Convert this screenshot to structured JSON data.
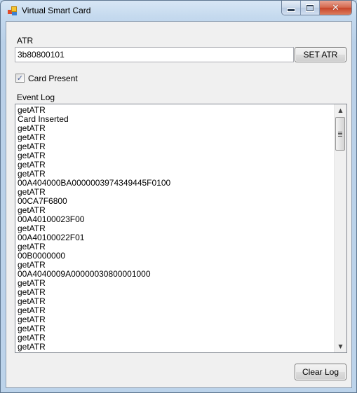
{
  "window": {
    "title": "Virtual Smart Card",
    "minimize_label": "minimize",
    "maximize_label": "maximize",
    "close_glyph": "✕"
  },
  "atr": {
    "label": "ATR",
    "value": "3b80800101",
    "set_button": "SET ATR"
  },
  "card_present": {
    "label": "Card Present",
    "checked": true,
    "check_glyph": "✓"
  },
  "event_log": {
    "label": "Event Log",
    "lines": [
      "getATR",
      "Card Inserted",
      "getATR",
      "getATR",
      "getATR",
      "getATR",
      "getATR",
      "getATR",
      "00A404000BA0000003974349445F0100",
      "getATR",
      "00CA7F6800",
      "getATR",
      "00A40100023F00",
      "getATR",
      "00A40100022F01",
      "getATR",
      "00B0000000",
      "getATR",
      "00A4040009A00000030800001000",
      "getATR",
      "getATR",
      "getATR",
      "getATR",
      "getATR",
      "getATR",
      "getATR",
      "getATR",
      "getATR"
    ],
    "scroll_up_glyph": "▲",
    "scroll_down_glyph": "▼"
  },
  "clear_button": "Clear Log"
}
